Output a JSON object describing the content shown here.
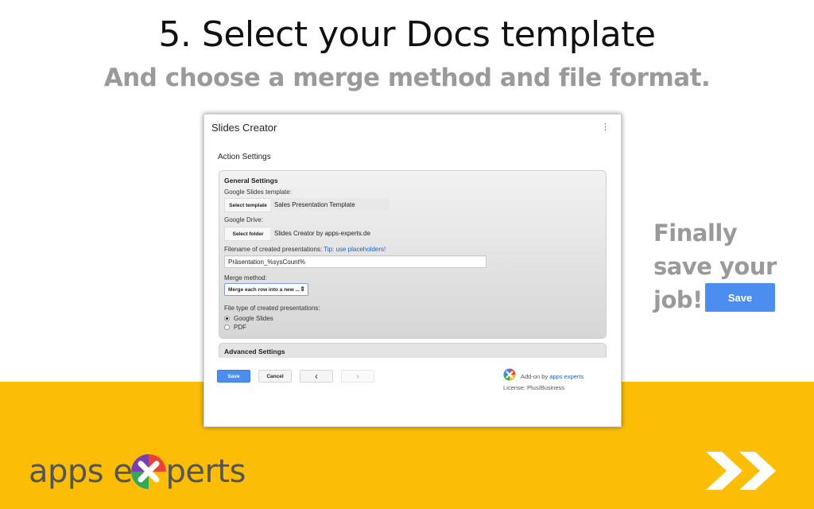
{
  "slide": {
    "title": "5. Select your Docs template",
    "subtitle": "And choose a merge method and file format.",
    "finally_text": "Finally save your job!",
    "big_save_label": "Save",
    "brand": {
      "left": "apps e",
      "right": "perts"
    }
  },
  "dialog": {
    "title": "Slides Creator",
    "menu_glyph": "⋮",
    "action_settings": "Action Settings",
    "general": {
      "heading": "General Settings",
      "template_label": "Google Slides template:",
      "select_template_btn": "Select template",
      "template_value": "Sales Presentation Template",
      "drive_label": "Google Drive:",
      "select_folder_btn": "Select folder",
      "folder_value": "Slides Creator by apps-experts.de",
      "filename_label": "Filename of created presentations:",
      "filename_tip": "Tip: use placeholders!",
      "filename_value": "Präsentation_%sysCount%",
      "merge_label": "Merge method:",
      "merge_value": "Merge each row into a new ...",
      "filetype_label": "File type of created presentations:",
      "filetype_options": [
        {
          "label": "Google Slides",
          "selected": true
        },
        {
          "label": "PDF",
          "selected": false
        }
      ]
    },
    "advanced_heading": "Advanced Settings",
    "buttons": {
      "save": "Save",
      "cancel": "Cancel",
      "prev": "‹",
      "next": "›"
    },
    "addon": {
      "prefix": "Add-on by",
      "link": "apps experts",
      "license": "License: Plus/Business"
    }
  },
  "colors": {
    "accent_blue": "#4c8ef0",
    "yellow": "#fbbd06",
    "gray_text": "#9a9a9a"
  }
}
